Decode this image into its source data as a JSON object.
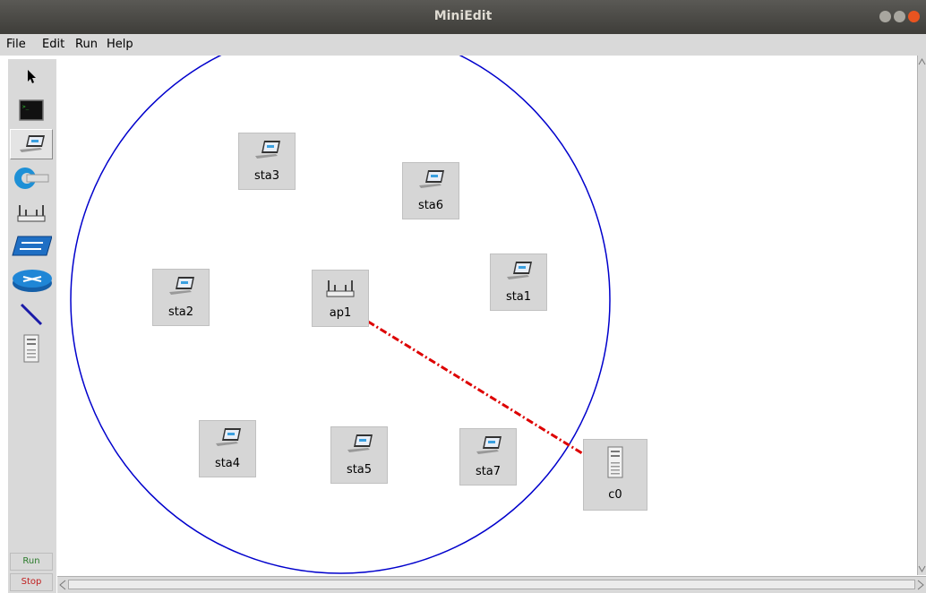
{
  "window": {
    "title": "MiniEdit"
  },
  "menu": [
    "File",
    "Edit",
    "Run",
    "Help"
  ],
  "toolbar": {
    "tools": [
      "select",
      "host",
      "station",
      "controller",
      "access-point",
      "switch",
      "router",
      "link",
      "controller-server"
    ],
    "selected": "station",
    "run_label": "Run",
    "stop_label": "Stop"
  },
  "colors": {
    "range_circle": "#0000cc",
    "controller_link": "#dd0000",
    "run_text": "#2a7a2a",
    "stop_text": "#c02020"
  },
  "nodes": [
    {
      "id": "sta3",
      "label": "sta3",
      "type": "station"
    },
    {
      "id": "sta6",
      "label": "sta6",
      "type": "station"
    },
    {
      "id": "sta2",
      "label": "sta2",
      "type": "station"
    },
    {
      "id": "ap1",
      "label": "ap1",
      "type": "access-point"
    },
    {
      "id": "sta1",
      "label": "sta1",
      "type": "station"
    },
    {
      "id": "sta4",
      "label": "sta4",
      "type": "station"
    },
    {
      "id": "sta5",
      "label": "sta5",
      "type": "station"
    },
    {
      "id": "sta7",
      "label": "sta7",
      "type": "station"
    },
    {
      "id": "c0",
      "label": "c0",
      "type": "controller"
    }
  ],
  "links": [
    {
      "from": "ap1",
      "to": "c0",
      "style": "dash-dot"
    }
  ]
}
